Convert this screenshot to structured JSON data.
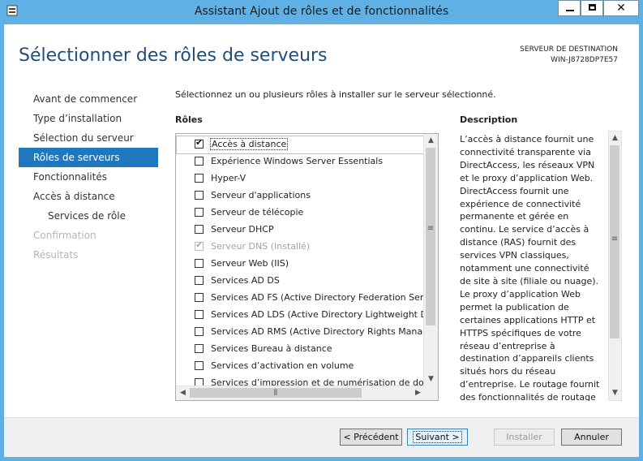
{
  "window": {
    "title": "Assistant Ajout de rôles et de fonctionnalités",
    "close_glyph": "✕"
  },
  "page": {
    "title": "Sélectionner des rôles de serveurs",
    "destination_label": "SERVEUR DE DESTINATION",
    "destination_name": "WIN-J8728DP7E57"
  },
  "nav": {
    "items": [
      {
        "label": "Avant de commencer",
        "state": "normal"
      },
      {
        "label": "Type d’installation",
        "state": "normal"
      },
      {
        "label": "Sélection du serveur",
        "state": "normal"
      },
      {
        "label": "Rôles de serveurs",
        "state": "active"
      },
      {
        "label": "Fonctionnalités",
        "state": "normal"
      },
      {
        "label": "Accès à distance",
        "state": "normal"
      },
      {
        "label": "Services de rôle",
        "state": "sub"
      },
      {
        "label": "Confirmation",
        "state": "disabled"
      },
      {
        "label": "Résultats",
        "state": "disabled"
      }
    ]
  },
  "main": {
    "instruction": "Sélectionnez un ou plusieurs rôles à installer sur le serveur sélectionné.",
    "roles_header": "Rôles",
    "description_header": "Description",
    "roles": [
      {
        "label": "Accès à distance",
        "checked": true,
        "disabled": false,
        "selected": true
      },
      {
        "label": "Expérience Windows Server Essentials",
        "checked": false,
        "disabled": false
      },
      {
        "label": "Hyper-V",
        "checked": false,
        "disabled": false
      },
      {
        "label": "Serveur d'applications",
        "checked": false,
        "disabled": false
      },
      {
        "label": "Serveur de télécopie",
        "checked": false,
        "disabled": false
      },
      {
        "label": "Serveur DHCP",
        "checked": false,
        "disabled": false
      },
      {
        "label": "Serveur DNS (Installé)",
        "checked": true,
        "disabled": true
      },
      {
        "label": "Serveur Web (IIS)",
        "checked": false,
        "disabled": false
      },
      {
        "label": "Services AD DS",
        "checked": false,
        "disabled": false
      },
      {
        "label": "Services AD FS (Active Directory Federation Services)",
        "checked": false,
        "disabled": false
      },
      {
        "label": "Services AD LDS (Active Directory Lightweight Directory Services)",
        "checked": false,
        "disabled": false
      },
      {
        "label": "Services AD RMS (Active Directory Rights Management Services)",
        "checked": false,
        "disabled": false
      },
      {
        "label": "Services Bureau à distance",
        "checked": false,
        "disabled": false
      },
      {
        "label": "Services d’activation en volume",
        "checked": false,
        "disabled": false
      },
      {
        "label": "Services d’impression et de numérisation de document",
        "checked": false,
        "disabled": false
      }
    ],
    "description": "L’accès à distance fournit une connectivité transparente via DirectAccess, les réseaux VPN et le proxy d’application Web. DirectAccess fournit une expérience de connectivité permanente et gérée en continu. Le service d’accès à distance (RAS) fournit des services VPN classiques, notamment une connectivité de site à site (filiale ou nuage). Le proxy d’application Web permet la publication de certaines applications HTTP et HTTPS spécifiques de votre réseau d’entreprise à destination d’appareils clients situés hors du réseau d’entreprise. Le routage fournit des fonctionnalités de routage classiques, notamment la traduction d’adresses réseau (NAT) et d’autres options de connectivité."
  },
  "footer": {
    "prev": "< Précédent",
    "next": "Suivant >",
    "install": "Installer",
    "cancel": "Annuler"
  }
}
